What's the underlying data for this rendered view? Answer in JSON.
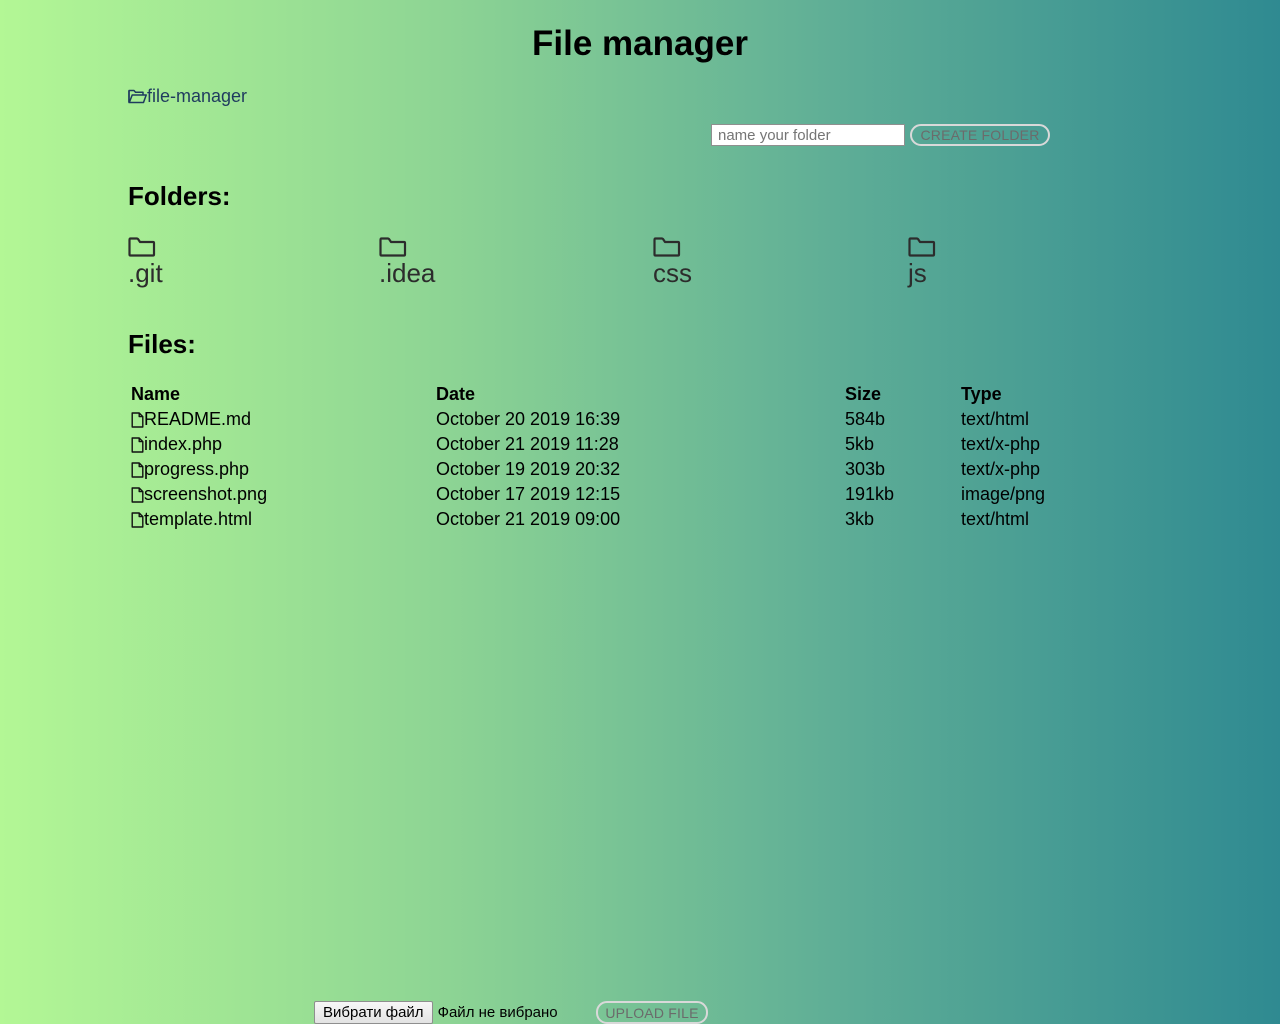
{
  "header": {
    "title": "File manager"
  },
  "breadcrumb": {
    "icon": "folder-open-icon",
    "label": "file-manager"
  },
  "create_folder": {
    "placeholder": "name your folder",
    "value": "",
    "button_label": "CREATE FOLDER"
  },
  "folders_section": {
    "heading": "Folders:",
    "icon": "folder-icon",
    "items": [
      {
        "name": ".git"
      },
      {
        "name": ".idea"
      },
      {
        "name": "css"
      },
      {
        "name": "js"
      }
    ]
  },
  "files_section": {
    "heading": "Files:",
    "icon": "file-icon",
    "columns": [
      "Name",
      "Date",
      "Size",
      "Type"
    ],
    "rows": [
      {
        "name": "README.md",
        "date": "October 20 2019 16:39",
        "size": "584b",
        "type": "text/html"
      },
      {
        "name": "index.php",
        "date": "October 21 2019 11:28",
        "size": "5kb",
        "type": "text/x-php"
      },
      {
        "name": "progress.php",
        "date": "October 19 2019 20:32",
        "size": "303b",
        "type": "text/x-php"
      },
      {
        "name": "screenshot.png",
        "date": "October 17 2019 12:15",
        "size": "191kb",
        "type": "image/png"
      },
      {
        "name": "template.html",
        "date": "October 21 2019 09:00",
        "size": "3kb",
        "type": "text/html"
      }
    ]
  },
  "upload": {
    "choose_button_label": "Вибрати файл",
    "no_file_text": "Файл не вибрано",
    "upload_button_label": "UPLOAD FILE"
  },
  "colors": {
    "gradient_start": "#b3f795",
    "gradient_end": "#2f8a91",
    "link": "#1f3b5e"
  }
}
